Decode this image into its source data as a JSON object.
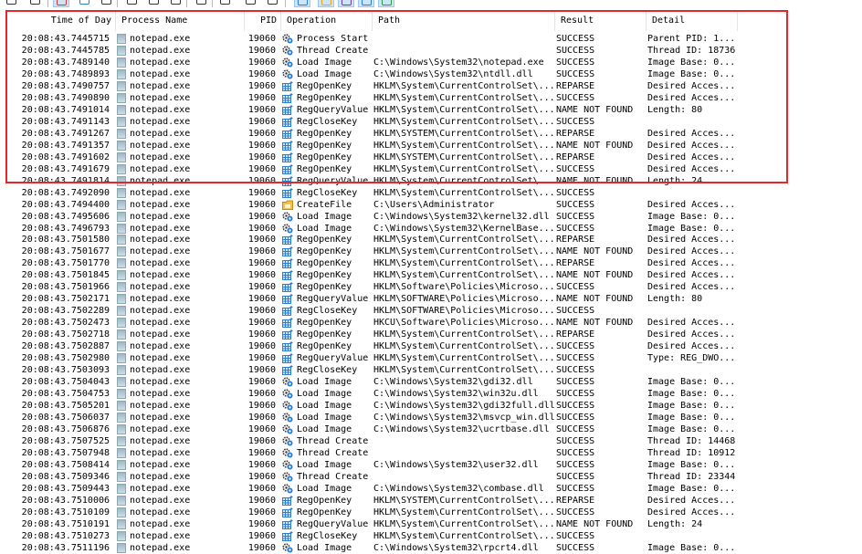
{
  "toolbar": {
    "buttons": [
      {
        "name": "open-icon",
        "active": false
      },
      {
        "name": "save-icon",
        "active": false
      },
      {
        "name": "capture-icon",
        "active": true
      },
      {
        "name": "autoscroll-icon",
        "active": false
      },
      {
        "name": "clear-icon",
        "active": false
      },
      {
        "name": "filter-icon",
        "active": false
      },
      {
        "name": "highlight-icon",
        "active": false
      },
      {
        "name": "include-process-icon",
        "active": false
      },
      {
        "name": "process-tree-icon",
        "active": false
      },
      {
        "name": "find-icon",
        "active": false
      },
      {
        "name": "search-icon",
        "active": false
      },
      {
        "name": "jump-to-icon",
        "active": false
      },
      {
        "name": "show-registry-icon",
        "active": true
      },
      {
        "name": "show-filesystem-icon",
        "active": true
      },
      {
        "name": "show-network-icon",
        "active": true
      },
      {
        "name": "show-process-icon",
        "active": true
      },
      {
        "name": "show-profiling-icon",
        "active": true
      }
    ]
  },
  "columns": {
    "time": "Time of Day",
    "process": "Process Name",
    "pid": "PID",
    "operation": "Operation",
    "path": "Path",
    "result": "Result",
    "detail": "Detail"
  },
  "colors": {
    "highlight_box": "#e8262a",
    "registry_icon": "#2a7fd4",
    "file_icon": "#e8a317",
    "process_icon": "#333333"
  },
  "rows": [
    [
      "20:08:43.7445715",
      "notepad.exe",
      "19060",
      "Process Start",
      "",
      "SUCCESS",
      "Parent PID: 1..."
    ],
    [
      "20:08:43.7445785",
      "notepad.exe",
      "19060",
      "Thread Create",
      "",
      "SUCCESS",
      "Thread ID: 18736"
    ],
    [
      "20:08:43.7489140",
      "notepad.exe",
      "19060",
      "Load Image",
      "C:\\Windows\\System32\\notepad.exe",
      "SUCCESS",
      "Image Base: 0..."
    ],
    [
      "20:08:43.7489893",
      "notepad.exe",
      "19060",
      "Load Image",
      "C:\\Windows\\System32\\ntdll.dll",
      "SUCCESS",
      "Image Base: 0..."
    ],
    [
      "20:08:43.7490757",
      "notepad.exe",
      "19060",
      "RegOpenKey",
      "HKLM\\System\\CurrentControlSet\\...",
      "REPARSE",
      "Desired Acces..."
    ],
    [
      "20:08:43.7490890",
      "notepad.exe",
      "19060",
      "RegOpenKey",
      "HKLM\\System\\CurrentControlSet\\...",
      "SUCCESS",
      "Desired Acces..."
    ],
    [
      "20:08:43.7491014",
      "notepad.exe",
      "19060",
      "RegQueryValue",
      "HKLM\\System\\CurrentControlSet\\...",
      "NAME NOT FOUND",
      "Length: 80"
    ],
    [
      "20:08:43.7491143",
      "notepad.exe",
      "19060",
      "RegCloseKey",
      "HKLM\\System\\CurrentControlSet\\...",
      "SUCCESS",
      ""
    ],
    [
      "20:08:43.7491267",
      "notepad.exe",
      "19060",
      "RegOpenKey",
      "HKLM\\SYSTEM\\CurrentControlSet\\...",
      "REPARSE",
      "Desired Acces..."
    ],
    [
      "20:08:43.7491357",
      "notepad.exe",
      "19060",
      "RegOpenKey",
      "HKLM\\System\\CurrentControlSet\\...",
      "NAME NOT FOUND",
      "Desired Acces..."
    ],
    [
      "20:08:43.7491602",
      "notepad.exe",
      "19060",
      "RegOpenKey",
      "HKLM\\SYSTEM\\CurrentControlSet\\...",
      "REPARSE",
      "Desired Acces..."
    ],
    [
      "20:08:43.7491679",
      "notepad.exe",
      "19060",
      "RegOpenKey",
      "HKLM\\System\\CurrentControlSet\\...",
      "SUCCESS",
      "Desired Acces..."
    ],
    [
      "20:08:43.7491814",
      "notepad.exe",
      "19060",
      "RegQueryValue",
      "HKLM\\System\\CurrentControlSet\\...",
      "NAME NOT FOUND",
      "Length: 24"
    ],
    [
      "20:08:43.7492090",
      "notepad.exe",
      "19060",
      "RegCloseKey",
      "HKLM\\System\\CurrentControlSet\\...",
      "SUCCESS",
      ""
    ],
    [
      "20:08:43.7494400",
      "notepad.exe",
      "19060",
      "CreateFile",
      "C:\\Users\\Administrator",
      "SUCCESS",
      "Desired Acces..."
    ],
    [
      "20:08:43.7495606",
      "notepad.exe",
      "19060",
      "Load Image",
      "C:\\Windows\\System32\\kernel32.dll",
      "SUCCESS",
      "Image Base: 0..."
    ],
    [
      "20:08:43.7496793",
      "notepad.exe",
      "19060",
      "Load Image",
      "C:\\Windows\\System32\\KernelBase...",
      "SUCCESS",
      "Image Base: 0..."
    ],
    [
      "20:08:43.7501580",
      "notepad.exe",
      "19060",
      "RegOpenKey",
      "HKLM\\System\\CurrentControlSet\\...",
      "REPARSE",
      "Desired Acces..."
    ],
    [
      "20:08:43.7501677",
      "notepad.exe",
      "19060",
      "RegOpenKey",
      "HKLM\\System\\CurrentControlSet\\...",
      "NAME NOT FOUND",
      "Desired Acces..."
    ],
    [
      "20:08:43.7501770",
      "notepad.exe",
      "19060",
      "RegOpenKey",
      "HKLM\\System\\CurrentControlSet\\...",
      "REPARSE",
      "Desired Acces..."
    ],
    [
      "20:08:43.7501845",
      "notepad.exe",
      "19060",
      "RegOpenKey",
      "HKLM\\System\\CurrentControlSet\\...",
      "NAME NOT FOUND",
      "Desired Acces..."
    ],
    [
      "20:08:43.7501966",
      "notepad.exe",
      "19060",
      "RegOpenKey",
      "HKLM\\Software\\Policies\\Microso...",
      "SUCCESS",
      "Desired Acces..."
    ],
    [
      "20:08:43.7502171",
      "notepad.exe",
      "19060",
      "RegQueryValue",
      "HKLM\\SOFTWARE\\Policies\\Microso...",
      "NAME NOT FOUND",
      "Length: 80"
    ],
    [
      "20:08:43.7502289",
      "notepad.exe",
      "19060",
      "RegCloseKey",
      "HKLM\\SOFTWARE\\Policies\\Microso...",
      "SUCCESS",
      ""
    ],
    [
      "20:08:43.7502473",
      "notepad.exe",
      "19060",
      "RegOpenKey",
      "HKCU\\Software\\Policies\\Microso...",
      "NAME NOT FOUND",
      "Desired Acces..."
    ],
    [
      "20:08:43.7502718",
      "notepad.exe",
      "19060",
      "RegOpenKey",
      "HKLM\\System\\CurrentControlSet\\...",
      "REPARSE",
      "Desired Acces..."
    ],
    [
      "20:08:43.7502887",
      "notepad.exe",
      "19060",
      "RegOpenKey",
      "HKLM\\System\\CurrentControlSet\\...",
      "SUCCESS",
      "Desired Acces..."
    ],
    [
      "20:08:43.7502980",
      "notepad.exe",
      "19060",
      "RegQueryValue",
      "HKLM\\System\\CurrentControlSet\\...",
      "SUCCESS",
      "Type: REG_DWO..."
    ],
    [
      "20:08:43.7503093",
      "notepad.exe",
      "19060",
      "RegCloseKey",
      "HKLM\\System\\CurrentControlSet\\...",
      "SUCCESS",
      ""
    ],
    [
      "20:08:43.7504043",
      "notepad.exe",
      "19060",
      "Load Image",
      "C:\\Windows\\System32\\gdi32.dll",
      "SUCCESS",
      "Image Base: 0..."
    ],
    [
      "20:08:43.7504753",
      "notepad.exe",
      "19060",
      "Load Image",
      "C:\\Windows\\System32\\win32u.dll",
      "SUCCESS",
      "Image Base: 0..."
    ],
    [
      "20:08:43.7505201",
      "notepad.exe",
      "19060",
      "Load Image",
      "C:\\Windows\\System32\\gdi32full.dll",
      "SUCCESS",
      "Image Base: 0..."
    ],
    [
      "20:08:43.7506037",
      "notepad.exe",
      "19060",
      "Load Image",
      "C:\\Windows\\System32\\msvcp_win.dll",
      "SUCCESS",
      "Image Base: 0..."
    ],
    [
      "20:08:43.7506876",
      "notepad.exe",
      "19060",
      "Load Image",
      "C:\\Windows\\System32\\ucrtbase.dll",
      "SUCCESS",
      "Image Base: 0..."
    ],
    [
      "20:08:43.7507525",
      "notepad.exe",
      "19060",
      "Thread Create",
      "",
      "SUCCESS",
      "Thread ID: 14468"
    ],
    [
      "20:08:43.7507948",
      "notepad.exe",
      "19060",
      "Thread Create",
      "",
      "SUCCESS",
      "Thread ID: 10912"
    ],
    [
      "20:08:43.7508414",
      "notepad.exe",
      "19060",
      "Load Image",
      "C:\\Windows\\System32\\user32.dll",
      "SUCCESS",
      "Image Base: 0..."
    ],
    [
      "20:08:43.7509346",
      "notepad.exe",
      "19060",
      "Thread Create",
      "",
      "SUCCESS",
      "Thread ID: 23344"
    ],
    [
      "20:08:43.7509443",
      "notepad.exe",
      "19060",
      "Load Image",
      "C:\\Windows\\System32\\combase.dll",
      "SUCCESS",
      "Image Base: 0..."
    ],
    [
      "20:08:43.7510006",
      "notepad.exe",
      "19060",
      "RegOpenKey",
      "HKLM\\SYSTEM\\CurrentControlSet\\...",
      "REPARSE",
      "Desired Acces..."
    ],
    [
      "20:08:43.7510109",
      "notepad.exe",
      "19060",
      "RegOpenKey",
      "HKLM\\System\\CurrentControlSet\\...",
      "SUCCESS",
      "Desired Acces..."
    ],
    [
      "20:08:43.7510191",
      "notepad.exe",
      "19060",
      "RegQueryValue",
      "HKLM\\System\\CurrentControlSet\\...",
      "NAME NOT FOUND",
      "Length: 24"
    ],
    [
      "20:08:43.7510273",
      "notepad.exe",
      "19060",
      "RegCloseKey",
      "HKLM\\System\\CurrentControlSet\\...",
      "SUCCESS",
      ""
    ],
    [
      "20:08:43.7511196",
      "notepad.exe",
      "19060",
      "Load Image",
      "C:\\Windows\\System32\\rpcrt4.dll",
      "SUCCESS",
      "Image Base: 0..."
    ]
  ]
}
